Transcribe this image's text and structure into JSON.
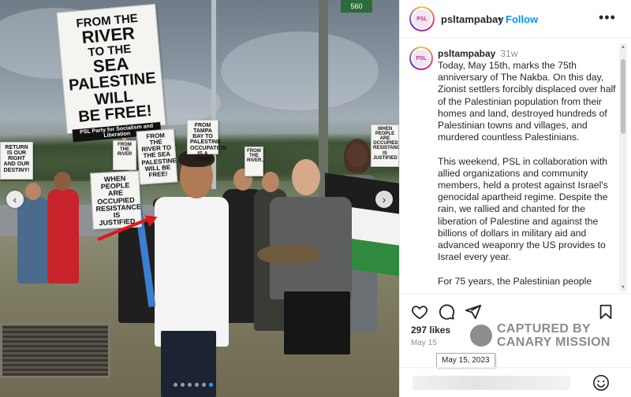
{
  "photo": {
    "street_sign": "560",
    "signs": {
      "main": [
        "FROM THE",
        "RIVER",
        "TO THE",
        "SEA",
        "PALESTINE",
        "WILL",
        "BE FREE!"
      ],
      "main_footer": "PSL Party for Socialism and Liberation",
      "left": "RETURN IS OUR RIGHT AND OUR DESTINY!",
      "when": "WHEN PEOPLE ARE OCCUPIED RESISTANCE IS JUSTIFIED",
      "river": "FROM THE RIVER TO THE SEA PALESTINE WILL BE FREE!",
      "tampa": "FROM TAMPA BAY TO PALESTINE OCCUPATION IS A CRIME",
      "small": "FROM THE RIVER...",
      "right": "WHEN PEOPLE ARE OCCUPIED RESISTANCE IS JUSTIFIED",
      "far_left": "FROM THE RIVER"
    },
    "carousel": {
      "prev": "‹",
      "next": "›",
      "slide_count": 6,
      "active_index": 5
    }
  },
  "header": {
    "avatar_text": "PSL",
    "username": "psltampabay",
    "separator": "•",
    "follow_label": "Follow",
    "more_label": "•••"
  },
  "post": {
    "username": "psltampabay",
    "time_ago": "31w",
    "caption": "Today, May 15th, marks the 75th anniversary of The Nakba. On this day, Zionist settlers forcibly displaced over half of the Palestinian population from their homes and land, destroyed hundreds of Palestinian towns and villages, and murdered countless Palestinians.\n\nThis weekend, PSL in collaboration with allied organizations and community members, held a protest against Israel's genocidal apartheid regime. Despite the rain, we rallied and chanted for the liberation of Palestine and against the billions of dollars in military aid and advanced weaponry the US provides to Israel every year.\n\nFor 75 years, the Palestinian people"
  },
  "actions": {
    "like_icon": "heart-icon",
    "comment_icon": "comment-icon",
    "share_icon": "share-icon",
    "save_icon": "bookmark-icon"
  },
  "likes": "297 likes",
  "date": "May 15",
  "tooltip": "May 15, 2023",
  "watermark": {
    "line1": "CAPTURED BY",
    "line2": "CANARY MISSION"
  },
  "colors": {
    "accent": "#0095f6",
    "arrow": "#e01818",
    "flag_green": "#2f8a3d",
    "flag_black": "#1d1d1d"
  }
}
